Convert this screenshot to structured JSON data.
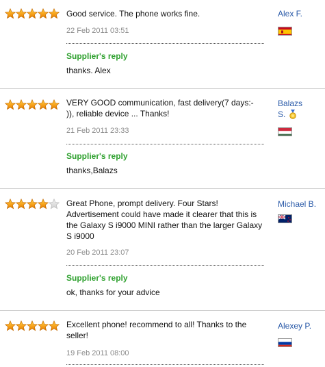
{
  "colors": {
    "star_fill": "#f39c12",
    "star_empty": "#d4d4d4",
    "reply_title": "#2fa12f",
    "user_link": "#2a5aa8",
    "date": "#8a8a8a"
  },
  "reviews": [
    {
      "rating": 5,
      "text": "Good service. The phone works fine.",
      "date": "22 Feb 2011 03:51",
      "reply_title": "Supplier's reply",
      "reply": "thanks. Alex",
      "user_line1": "Alex F.",
      "user_line2": "",
      "flag": "spain-flag-icon"
    },
    {
      "rating": 5,
      "text_lines": [
        "VERY GOOD communication, fast delivery(7 days:-",
        ")), reliable device ... Thanks!"
      ],
      "date": "21 Feb 2011 23:33",
      "reply_title": "Supplier's reply",
      "reply": "thanks,Balazs",
      "user_line1": "Balazs",
      "user_line2": "S.",
      "badge": "medal-icon",
      "flag": "hungary-flag-icon"
    },
    {
      "rating": 4,
      "text_lines": [
        "Great Phone, prompt delivery. Four Stars!",
        "Advertisement could have made it clearer that this is",
        "the Galaxy S i9000 MINI rather than the larger Galaxy",
        "S i9000"
      ],
      "date": "20 Feb 2011 23:07",
      "reply_title": "Supplier's reply",
      "reply": "ok, thanks for your advice",
      "user_line1": "Michael B.",
      "user_line2": "",
      "flag": "new-zealand-flag-icon"
    },
    {
      "rating": 5,
      "text_lines": [
        "Excellent phone! recommend to all! Thanks to the",
        "seller!"
      ],
      "date": "19 Feb 2011 08:00",
      "user_line1": "Alexey P.",
      "user_line2": "",
      "flag": "russia-flag-icon"
    }
  ]
}
